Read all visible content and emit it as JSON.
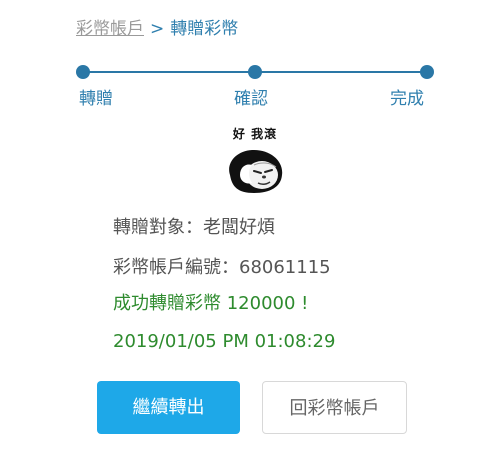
{
  "breadcrumb": {
    "parent": "彩幣帳戶",
    "separator": ">",
    "current": "轉贈彩幣"
  },
  "steps": [
    {
      "label": "轉贈"
    },
    {
      "label": "確認"
    },
    {
      "label": "完成"
    }
  ],
  "meme": {
    "caption": "好 我滾"
  },
  "result": {
    "recipient": "轉贈對象：老闆好煩",
    "account": "彩幣帳戶編號：68061115",
    "success": "成功轉贈彩幣 120000 !",
    "timestamp": "2019/01/05 PM 01:08:29"
  },
  "buttons": {
    "continue": "繼續轉出",
    "back": "回彩幣帳戶"
  },
  "colors": {
    "accent": "#2a77a6",
    "primary_button": "#1ea8e8",
    "success_text": "#2e8b2e"
  }
}
